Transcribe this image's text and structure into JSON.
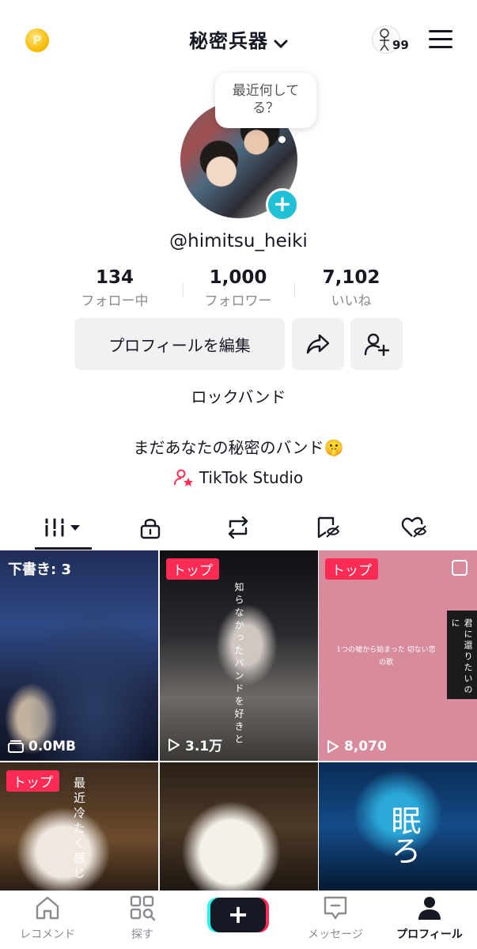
{
  "header": {
    "title": "秘密兵器",
    "notification_count": "99",
    "coin_icon": "coin-icon",
    "menu_icon": "hamburger-icon"
  },
  "profile": {
    "bubble_text": "最近何してる？",
    "username": "@himitsu_heiki",
    "stats": [
      {
        "value": "134",
        "label": "フォロー中"
      },
      {
        "value": "1,000",
        "label": "フォロワー"
      },
      {
        "value": "7,102",
        "label": "いいね"
      }
    ],
    "edit_button": "プロフィールを編集",
    "bio_line1": "ロックバンド",
    "bio_line2": "まだあなたの秘密のバンド🤫",
    "studio_link": "TikTok Studio"
  },
  "tabs": [
    "videos-grid-icon",
    "lock-icon",
    "repost-icon",
    "saved-icon",
    "liked-icon"
  ],
  "grid": [
    {
      "tag": "",
      "overlay": "下書き: 3",
      "meta": "0.0MB"
    },
    {
      "tag": "トップ",
      "overlay": "知らなかったバンドを好きと",
      "meta": "3.1万"
    },
    {
      "tag": "トップ",
      "overlay": "1つの嘘から始まった 切ない恋の歌",
      "side_text": "君に還りたいのに",
      "meta": "8,070"
    },
    {
      "tag": "トップ",
      "overlay": "最近冷たく感じ",
      "meta": ""
    },
    {
      "tag": "",
      "overlay": "",
      "meta": ""
    },
    {
      "tag": "",
      "overlay": "眠ろ",
      "meta": ""
    }
  ],
  "bottom_nav": [
    {
      "label": "レコメンド",
      "icon": "home-icon"
    },
    {
      "label": "探す",
      "icon": "discover-icon"
    },
    {
      "label": "",
      "icon": "create-plus-icon"
    },
    {
      "label": "メッセージ",
      "icon": "inbox-icon"
    },
    {
      "label": "プロフィール",
      "icon": "profile-icon"
    }
  ],
  "colors": {
    "accent": "#fe2c55",
    "teal": "#20c0d7",
    "text": "#161823",
    "muted": "#8a8b91"
  }
}
